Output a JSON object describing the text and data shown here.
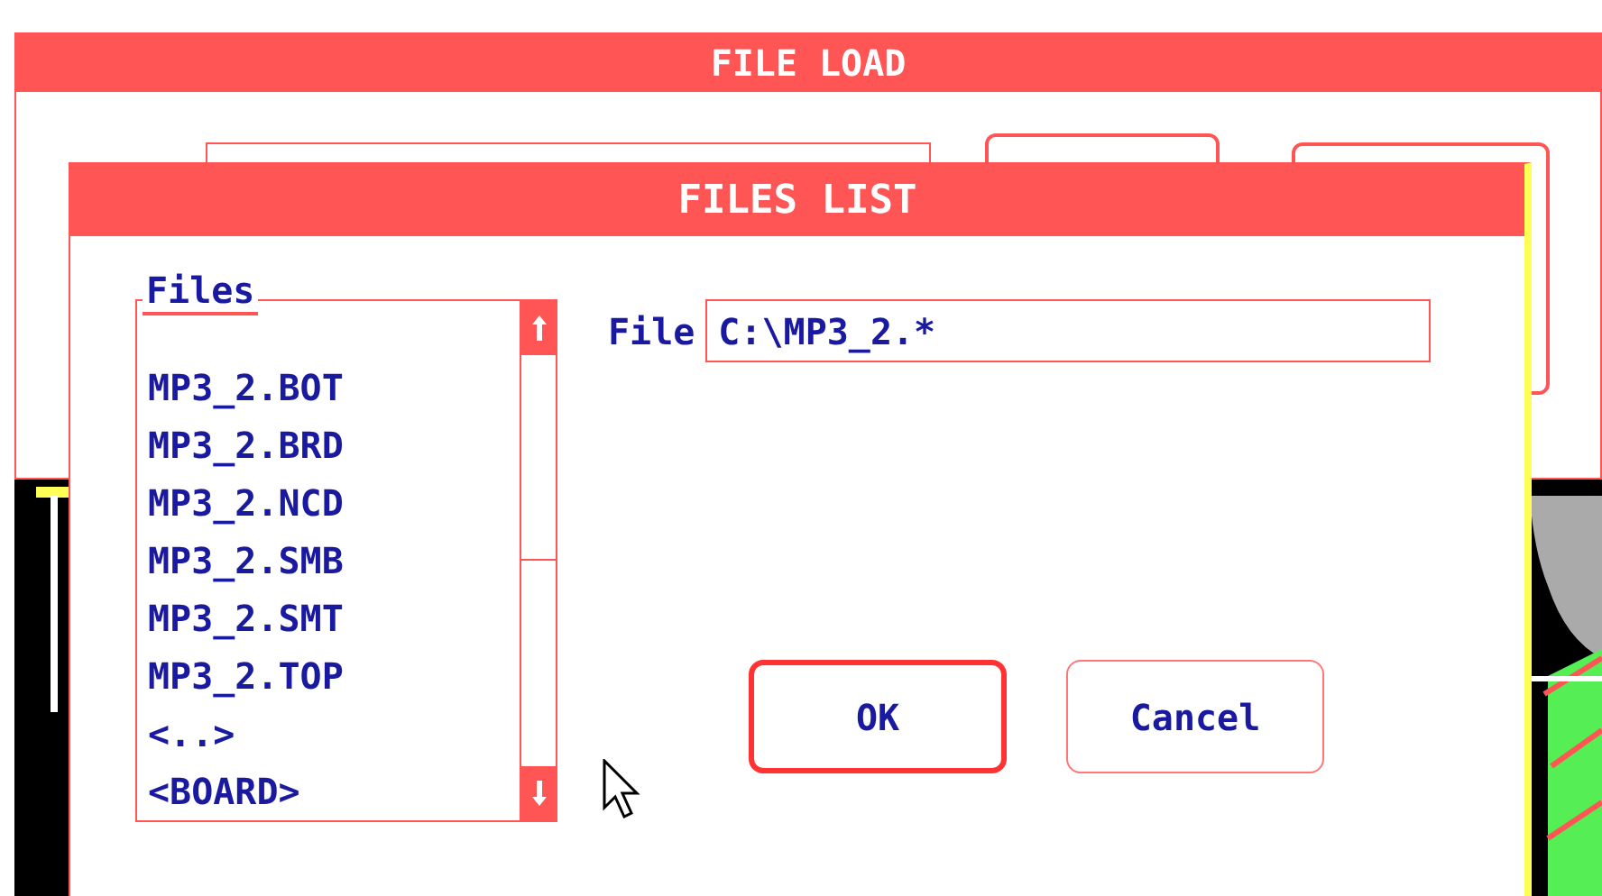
{
  "outer_window": {
    "title": "FILE LOAD"
  },
  "dialog": {
    "title": "FILES LIST",
    "files_label": "Files",
    "files": [
      "MP3_2.BOT",
      "MP3_2.BRD",
      "MP3_2.NCD",
      "MP3_2.SMB",
      "MP3_2.SMT",
      "MP3_2.TOP",
      "<..>",
      "<BOARD>"
    ],
    "file_label": "File",
    "file_value": "C:\\MP3_2.*",
    "buttons": [
      {
        "label": "OK",
        "default": true
      },
      {
        "label": "Cancel",
        "default": false
      }
    ]
  }
}
